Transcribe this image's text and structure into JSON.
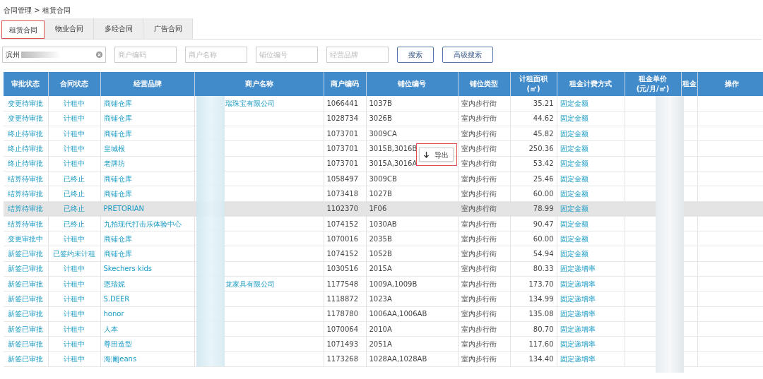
{
  "breadcrumb": "合同管理 > 租赁合同",
  "tabs": [
    {
      "label": "租赁合同",
      "selected": true
    },
    {
      "label": "物业合同",
      "selected": false
    },
    {
      "label": "多经合同",
      "selected": false
    },
    {
      "label": "广告合同",
      "selected": false
    }
  ],
  "filters": [
    {
      "kind": "value",
      "text": "滨州"
    },
    {
      "kind": "placeholder",
      "placeholder": "商户编码"
    },
    {
      "kind": "placeholder",
      "placeholder": "商户名称"
    },
    {
      "kind": "placeholder",
      "placeholder": "铺位编号"
    },
    {
      "kind": "placeholder",
      "placeholder": "经营品牌"
    }
  ],
  "buttons": [
    "搜索",
    "高级搜索"
  ],
  "table": {
    "columns": [
      "审批状态",
      "合同状态",
      "经营品牌",
      "商户名称",
      "商户编码",
      "铺位编号",
      "铺位类型",
      "计租面积\n(㎡)",
      "租金计费方式",
      "租金单价\n(元/月/㎡)",
      "租金",
      "操作"
    ],
    "rows": [
      {
        "cells": [
          "变更待审批",
          "计租中",
          "商铺仓库",
          "瑞珠宝有限公司",
          "1066441",
          "1037B",
          "室内步行街",
          "35.21",
          "固定金额"
        ],
        "highlighted": false
      },
      {
        "cells": [
          "变更待审批",
          "计租中",
          "商铺仓库",
          "",
          "1028734",
          "3026B",
          "室内步行街",
          "44.62",
          "固定金额"
        ],
        "highlighted": false
      },
      {
        "cells": [
          "终止待审批",
          "计租中",
          "商铺仓库",
          "",
          "1073701",
          "3009CA",
          "室内步行街",
          "45.82",
          "固定金额"
        ],
        "highlighted": false
      },
      {
        "cells": [
          "终止待审批",
          "计租中",
          "皇城根",
          "",
          "1073701",
          "3015B,3016B",
          "室内步行街",
          "250.36",
          "固定金额"
        ],
        "highlighted": false
      },
      {
        "cells": [
          "终止待审批",
          "计租中",
          "老牌坊",
          "",
          "1073701",
          "3015A,3016A",
          "室内步行街",
          "53.42",
          "固定金额"
        ],
        "highlighted": false
      },
      {
        "cells": [
          "结算待审批",
          "已终止",
          "商铺仓库",
          "",
          "1058497",
          "3009CB",
          "室内步行街",
          "25.46",
          "固定金额"
        ],
        "highlighted": false
      },
      {
        "cells": [
          "结算待审批",
          "已终止",
          "商铺仓库",
          "",
          "1073418",
          "1027B",
          "室内步行街",
          "60.00",
          "固定金额"
        ],
        "highlighted": false
      },
      {
        "cells": [
          "结算待审批",
          "已终止",
          "PRETORIAN",
          "",
          "1102370",
          "1F06",
          "室内步行街",
          "78.99",
          "固定金额"
        ],
        "highlighted": true
      },
      {
        "cells": [
          "结算待审批",
          "已终止",
          "九拍现代打击乐体验中心",
          "",
          "1074152",
          "1030AB",
          "室内步行街",
          "90.47",
          "固定金额"
        ],
        "highlighted": false
      },
      {
        "cells": [
          "变更审批中",
          "计租中",
          "商铺仓库",
          "",
          "1070016",
          "2035B",
          "室内步行街",
          "60.00",
          "固定金额"
        ],
        "highlighted": false
      },
      {
        "cells": [
          "新签已审批",
          "已签约未计租",
          "商铺仓库",
          "",
          "1074152",
          "1052B",
          "室内步行街",
          "54.94",
          "固定金额"
        ],
        "highlighted": false
      },
      {
        "cells": [
          "新签已审批",
          "计租中",
          "Skechers kids",
          "",
          "1030516",
          "2015A",
          "室内步行街",
          "80.33",
          "固定递增率"
        ],
        "highlighted": false
      },
      {
        "cells": [
          "新签已审批",
          "计租中",
          "恩瑞妮",
          "龙家具有限公司",
          "1177548",
          "1009A,1009B",
          "室内步行街",
          "173.70",
          "固定递增率"
        ],
        "highlighted": false
      },
      {
        "cells": [
          "新签已审批",
          "计租中",
          "S.DEER",
          "",
          "1118872",
          "1023A",
          "室内步行街",
          "134.99",
          "固定递增率"
        ],
        "highlighted": false
      },
      {
        "cells": [
          "新签已审批",
          "计租中",
          "honor",
          "",
          "1178780",
          "1006AA,1006AB",
          "室内步行街",
          "135.08",
          "固定递增率"
        ],
        "highlighted": false
      },
      {
        "cells": [
          "新签已审批",
          "计租中",
          "人本",
          "",
          "1070064",
          "2010A",
          "室内步行街",
          "80.70",
          "固定递增率"
        ],
        "highlighted": false
      },
      {
        "cells": [
          "新签已审批",
          "计租中",
          "尊田造型",
          "",
          "1071493",
          "2051A",
          "室内步行街",
          "117.60",
          "固定递增率"
        ],
        "highlighted": false
      },
      {
        "cells": [
          "新签已审批",
          "计租中",
          "海澜jeans",
          "",
          "1173268",
          "1028AA,1028AB",
          "室内步行街",
          "134.40",
          "固定递增率"
        ],
        "highlighted": false
      }
    ]
  },
  "context_menu": {
    "item": "导出"
  }
}
